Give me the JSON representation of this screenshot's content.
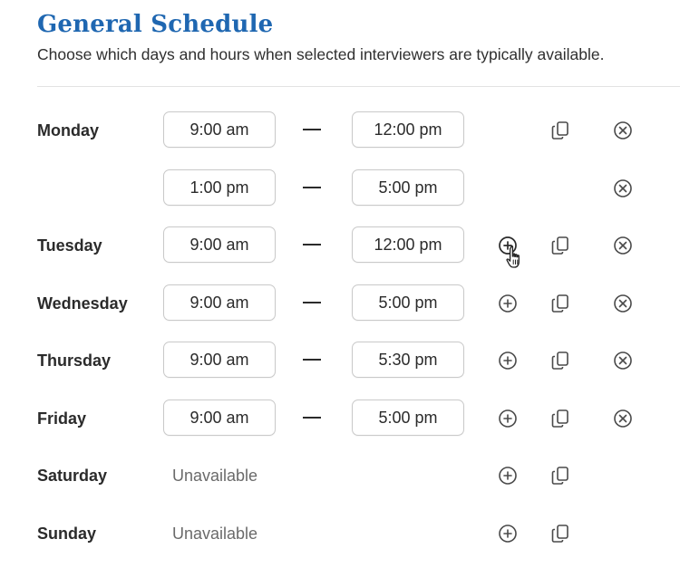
{
  "header": {
    "title": "General Schedule",
    "subtitle": "Choose which days and hours when selected interviewers are typically available."
  },
  "schedule": {
    "monday": {
      "label": "Monday",
      "slots": [
        {
          "start": "9:00 am",
          "end": "12:00 pm"
        },
        {
          "start": "1:00 pm",
          "end": "5:00 pm"
        }
      ]
    },
    "tuesday": {
      "label": "Tuesday",
      "slots": [
        {
          "start": "9:00 am",
          "end": "12:00 pm"
        }
      ]
    },
    "wednesday": {
      "label": "Wednesday",
      "slots": [
        {
          "start": "9:00 am",
          "end": "5:00 pm"
        }
      ]
    },
    "thursday": {
      "label": "Thursday",
      "slots": [
        {
          "start": "9:00 am",
          "end": "5:30 pm"
        }
      ]
    },
    "friday": {
      "label": "Friday",
      "slots": [
        {
          "start": "9:00 am",
          "end": "5:00 pm"
        }
      ]
    },
    "saturday": {
      "label": "Saturday",
      "status": "Unavailable"
    },
    "sunday": {
      "label": "Sunday",
      "status": "Unavailable"
    }
  },
  "icons": {
    "add": "plus-circle-icon",
    "copy": "copy-icon",
    "remove": "x-circle-icon",
    "cursor": "hand-pointer-icon"
  },
  "colors": {
    "title": "#1f67b1",
    "text": "#2b2b2b",
    "muted": "#6a6a6a",
    "border": "#c9c9c9"
  }
}
